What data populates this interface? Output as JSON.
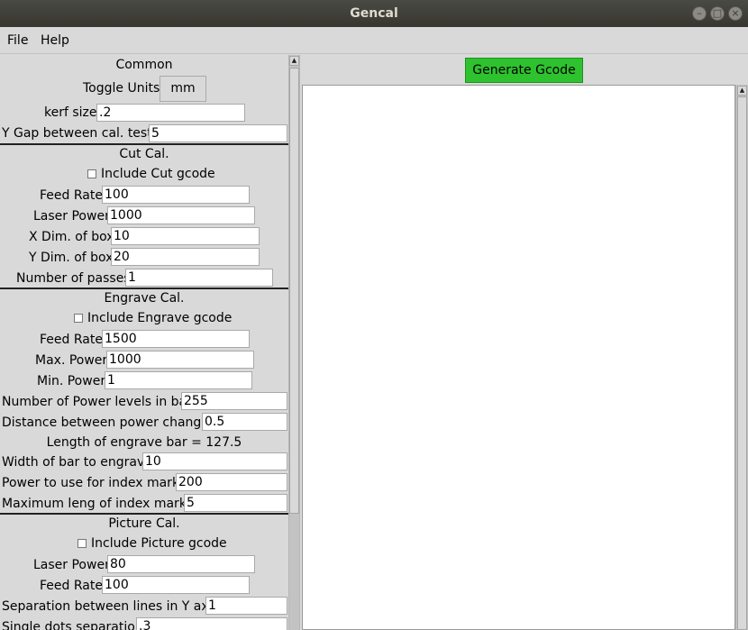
{
  "window": {
    "title": "Gencal"
  },
  "menu": {
    "file": "File",
    "help": "Help"
  },
  "common": {
    "heading": "Common",
    "toggle_label": "Toggle Units",
    "units": "mm",
    "kerf_label": "kerf size",
    "kerf_value": ".2",
    "ygap_label": "Y Gap between cal. tests",
    "ygap_value": "5"
  },
  "cut": {
    "heading": "Cut Cal.",
    "include_label": "Include Cut gcode",
    "include_checked": false,
    "feed_label": "Feed Rate",
    "feed_value": "100",
    "power_label": "Laser Power",
    "power_value": "1000",
    "xdim_label": "X Dim. of box",
    "xdim_value": "10",
    "ydim_label": "Y Dim. of box",
    "ydim_value": "20",
    "passes_label": "Number of passes",
    "passes_value": "1"
  },
  "engrave": {
    "heading": "Engrave Cal.",
    "include_label": "Include Engrave gcode",
    "include_checked": false,
    "feed_label": "Feed Rate",
    "feed_value": "1500",
    "maxp_label": "Max. Power",
    "maxp_value": "1000",
    "minp_label": "Min. Power",
    "minp_value": "1",
    "levels_label": "Number of Power levels in bar",
    "levels_value": "255",
    "dist_label": "Distance between power changes",
    "dist_value": "0.5",
    "length_text": "Length of engrave bar = 127.5",
    "width_label": "Width of bar to engrave",
    "width_value": "10",
    "idxpower_label": "Power to use for index marks",
    "idxpower_value": "200",
    "maxleng_label": "Maximum leng of index marks",
    "maxleng_value": "5"
  },
  "picture": {
    "heading": "Picture Cal.",
    "include_label": "Include Picture gcode",
    "include_checked": false,
    "power_label": "Laser Power",
    "power_value": "80",
    "feed_label": "Feed Rate",
    "feed_value": "100",
    "sep_label": "Separation between lines in Y axis",
    "sep_value": "1",
    "dots_label": "Single dots separation",
    "dots_value": ".3"
  },
  "generate": {
    "label": "Generate Gcode",
    "color": "#2ec22e"
  },
  "output": {
    "text": ""
  }
}
